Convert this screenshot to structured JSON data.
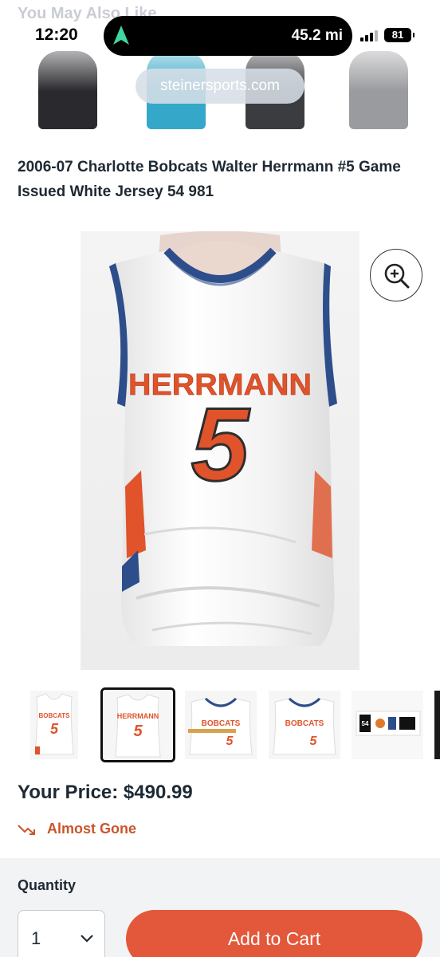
{
  "status_bar": {
    "time": "12:20",
    "distance": "45.2 mi",
    "battery": "81"
  },
  "you_may_also_like": {
    "title": "You May Also Like"
  },
  "browser": {
    "url": "steinersports.com"
  },
  "related_items": [
    {
      "color": "#2a2a2e"
    },
    {
      "color": "#35a8c9"
    },
    {
      "color": "#3b3c40"
    },
    {
      "color": "#9a9b9e"
    }
  ],
  "product": {
    "title": "2006-07 Charlotte Bobcats Walter Herrmann #5 Game Issued White Jersey 54 981",
    "jersey_name": "HERRMANN",
    "jersey_number": "5",
    "price_label": "Your Price: $490.99",
    "stock_status": "Almost Gone"
  },
  "thumbnails": [
    {
      "name": "BOBCATS",
      "number": "5",
      "label": "front"
    },
    {
      "name": "HERRMANN",
      "number": "5",
      "label": "back",
      "selected": true
    },
    {
      "name": "BOBCATS",
      "number": "5",
      "label": "front-measure"
    },
    {
      "name": "BOBCATS",
      "number": "5",
      "label": "front-detail"
    },
    {
      "tag": "54",
      "label": "tag"
    }
  ],
  "purchase": {
    "quantity_label": "Quantity",
    "quantity_value": "1",
    "add_to_cart_label": "Add to Cart"
  },
  "colors": {
    "accent": "#e3573a",
    "stock_text": "#c8562b",
    "jersey_orange": "#e0532b",
    "jersey_navy": "#2d4e8a",
    "panel_bg": "#f2f3f5"
  },
  "icons": {
    "zoom": "zoom-in-icon",
    "trend": "trending-down-icon",
    "chevron": "chevron-down-icon",
    "nav": "navigation-arrow-icon"
  }
}
